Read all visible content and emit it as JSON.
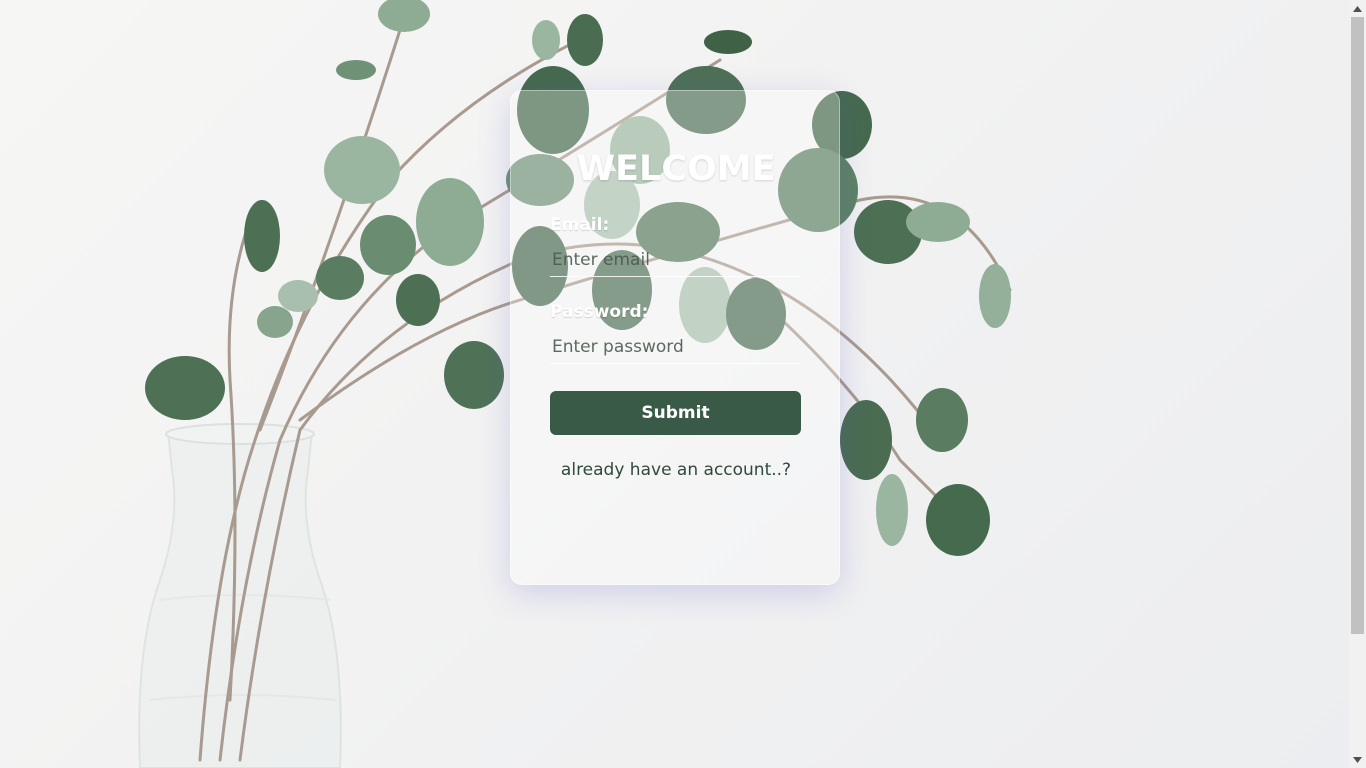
{
  "login_card": {
    "title": "WELCOME",
    "email_label": "Email:",
    "email_placeholder": "Enter email",
    "email_value": "",
    "password_label": "Password:",
    "password_placeholder": "Enter password",
    "password_value": "",
    "submit_label": "Submit",
    "account_link": "already have an account..?"
  },
  "colors": {
    "button": "#3a5a48",
    "leaf": "#5b7f62",
    "leaf_light": "#9bb6a0",
    "stem": "#a89a8f"
  },
  "background": {
    "image": "eucalyptus-in-glass-vase"
  },
  "scrollbar": {
    "thumb_fraction": 0.84
  }
}
